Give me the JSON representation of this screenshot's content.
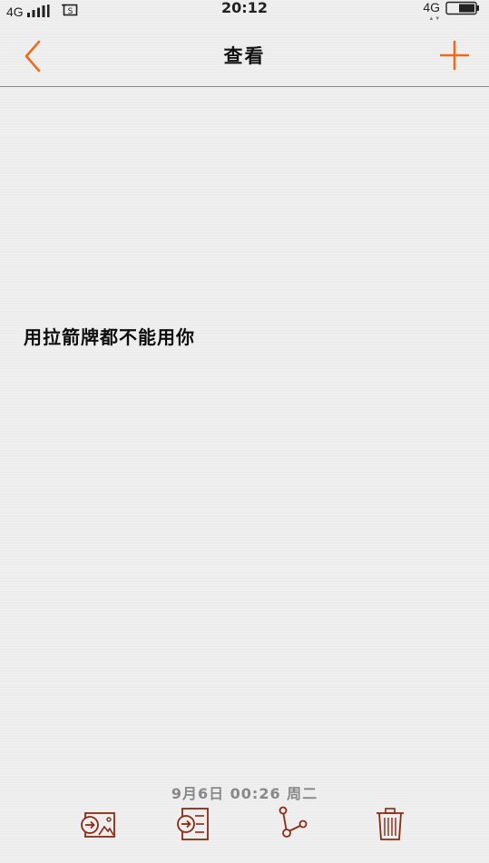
{
  "status_bar": {
    "network_left": "4G",
    "time": "20:12",
    "network_right": "4G",
    "icons": [
      "signal-bars-icon",
      "sim-card-icon",
      "data-arrows-icon",
      "battery-icon"
    ]
  },
  "nav": {
    "title": "查看",
    "back_icon": "chevron-left-icon",
    "add_icon": "plus-icon",
    "accent_color": "#ee6a1c"
  },
  "note": {
    "content": "用拉箭牌都不能用你",
    "date": "9月6日 00:26 周二"
  },
  "toolbar": {
    "icon_color": "#8a2a12",
    "items": [
      {
        "icon": "export-image-icon"
      },
      {
        "icon": "export-text-icon"
      },
      {
        "icon": "share-icon"
      },
      {
        "icon": "trash-icon"
      }
    ]
  }
}
